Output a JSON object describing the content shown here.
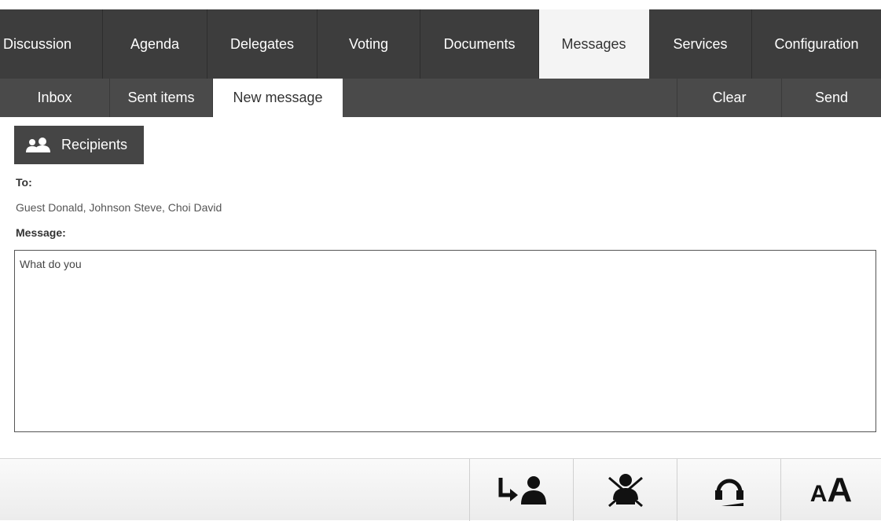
{
  "nav": {
    "tabs": [
      {
        "label": "Discussion"
      },
      {
        "label": "Agenda"
      },
      {
        "label": "Delegates"
      },
      {
        "label": "Voting"
      },
      {
        "label": "Documents"
      },
      {
        "label": "Messages",
        "active": true
      },
      {
        "label": "Services"
      },
      {
        "label": "Configuration"
      }
    ]
  },
  "subnav": {
    "inbox": "Inbox",
    "sent": "Sent items",
    "new_message": "New message",
    "clear": "Clear",
    "send": "Send"
  },
  "compose": {
    "recipients_button": "Recipients",
    "to_label": "To:",
    "to_value": "Guest Donald, Johnson Steve, Choi David",
    "message_label": "Message:",
    "message_value": "What do you"
  },
  "bottombar": {
    "buttons": [
      {
        "icon": "request-to-speak-icon"
      },
      {
        "icon": "microphone-mute-icon"
      },
      {
        "icon": "headset-icon"
      },
      {
        "icon": "font-size-icon",
        "small": "A",
        "big": "A"
      }
    ]
  },
  "colors": {
    "nav_bg": "#3d3d3d",
    "subnav_bg": "#4a4a4a",
    "active_tab": "#f4f4f4"
  }
}
